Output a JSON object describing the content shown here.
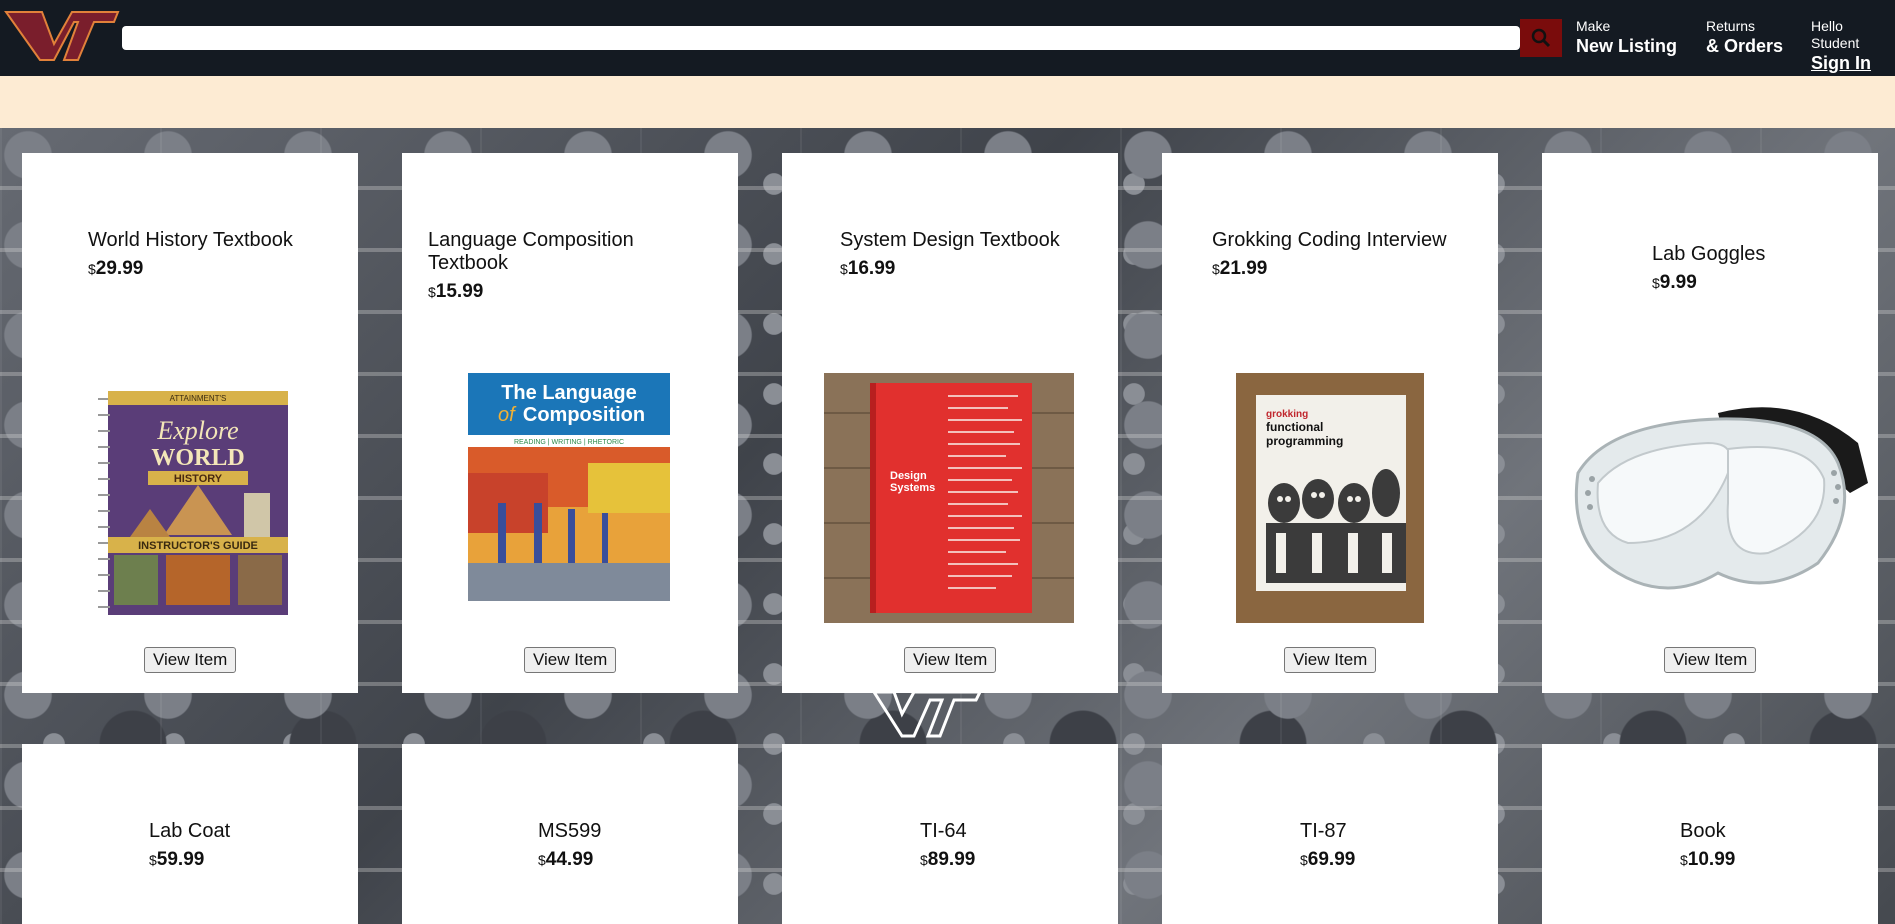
{
  "nav": {
    "logo": "VT",
    "search": {
      "placeholder": "",
      "value": ""
    },
    "listing_small": "Make",
    "listing_big": "New Listing",
    "orders_small": "Returns",
    "orders_big": "& Orders",
    "account_small": "Hello Student",
    "account_big": "Sign In"
  },
  "currency": "$",
  "items": [
    {
      "title": "World History Textbook",
      "price": "29.99",
      "button": "View Item"
    },
    {
      "title": "Language Composition Textbook",
      "price": "15.99",
      "button": "View Item"
    },
    {
      "title": "System Design Textbook",
      "price": "16.99",
      "button": "View Item"
    },
    {
      "title": "Grokking Coding Interview",
      "price": "21.99",
      "button": "View Item"
    },
    {
      "title": "Lab Goggles",
      "price": "9.99",
      "button": "View Item"
    },
    {
      "title": "Lab Coat",
      "price": "59.99"
    },
    {
      "title": "MS599",
      "price": "44.99"
    },
    {
      "title": "TI-64",
      "price": "89.99"
    },
    {
      "title": "TI-87",
      "price": "69.99"
    },
    {
      "title": "Book",
      "price": "10.99"
    }
  ],
  "covers": {
    "world_history": {
      "top": "ATTAINMENT'S",
      "line1": "Explore",
      "line2": "WORLD",
      "line3": "HISTORY",
      "banner": "INSTRUCTOR'S GUIDE"
    },
    "composition": {
      "line1": "The Language",
      "line2a": "of",
      "line2b": "Composition",
      "sub": "READING | WRITING | RHETORIC"
    },
    "design": {
      "line1": "Design",
      "line2": "Systems"
    },
    "grokking": {
      "line1": "grokking",
      "line2": "functional",
      "line3": "programming"
    }
  }
}
